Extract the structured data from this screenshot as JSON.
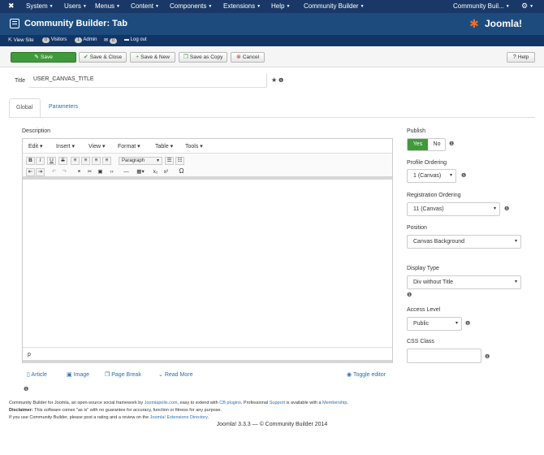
{
  "topnav": {
    "items": [
      "System",
      "Users",
      "Menus",
      "Content",
      "Components",
      "Extensions",
      "Help",
      "Community Builder"
    ],
    "right_item": "Community Buil..."
  },
  "header": {
    "title": "Community Builder: Tab",
    "brand": "Joomla!"
  },
  "status": {
    "view_site": "View Site",
    "visitors_count": "0",
    "visitors_label": "Visitors",
    "admin_count": "1",
    "admin_label": "Admin",
    "messages_count": "0",
    "logout": "Log out"
  },
  "toolbar": {
    "save": "Save",
    "save_close": "Save & Close",
    "save_new": "Save & New",
    "save_copy": "Save as Copy",
    "cancel": "Cancel",
    "help": "Help"
  },
  "form": {
    "title_label": "Title",
    "title_value": "USER_CANVAS_TITLE"
  },
  "tabs": [
    "Global",
    "Parameters"
  ],
  "editor": {
    "description_label": "Description",
    "menu": [
      "Edit",
      "Insert",
      "View",
      "Format",
      "Table",
      "Tools"
    ],
    "paragraph_select": "Paragraph",
    "status_path": "p",
    "buttons": [
      "Article",
      "Image",
      "Page Break",
      "Read More"
    ],
    "toggle": "Toggle editor"
  },
  "sidebar": {
    "publish_label": "Publish",
    "publish_yes": "Yes",
    "publish_no": "No",
    "profile_ordering_label": "Profile Ordering",
    "profile_ordering_value": "1 (Canvas)",
    "registration_ordering_label": "Registration Ordering",
    "registration_ordering_value": "11 (Canvas)",
    "position_label": "Position",
    "position_value": "Canvas Background",
    "display_type_label": "Display Type",
    "display_type_value": "Div without Title",
    "access_level_label": "Access Level",
    "access_level_value": "Public",
    "css_class_label": "CSS Class",
    "css_class_value": ""
  },
  "footer": {
    "line1_a": "Community Builder for Joomla, an open-source social framework by ",
    "line1_link1": "Joomlapolis.com",
    "line1_b": ", easy to extend with ",
    "line1_link2": "CB plugins",
    "line1_c": ". Professional ",
    "line1_link3": "Support",
    "line1_d": " is available with a ",
    "line1_link4": "Membership",
    "line1_e": ".",
    "disclaimer_label": "Disclaimer:",
    "disclaimer_text": " This software comes \"as is\" with no guarantee for accuracy, function or fitness for any purpose.",
    "line3_a": "If you use Community Builder, please post a rating and a review on the ",
    "line3_link": "Joomla! Extensions Directory",
    "line3_b": ".",
    "copyright": "Joomla! 3.3.3  —  © Community Builder 2014"
  },
  "colors": {
    "topnav_bg": "#1a3867",
    "header_bg": "#1d4b7d",
    "save_green": "#3f9a3a",
    "link_blue": "#2a6fb0"
  }
}
